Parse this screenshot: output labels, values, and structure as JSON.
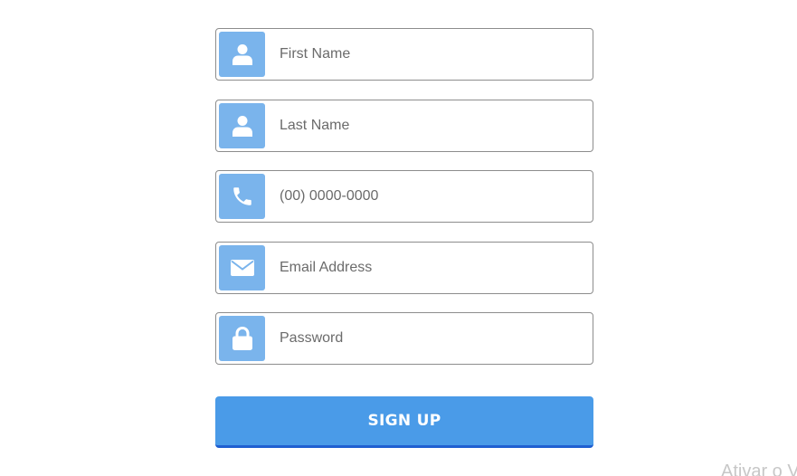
{
  "form": {
    "fields": [
      {
        "icon": "user-icon",
        "placeholder": "First Name",
        "value": ""
      },
      {
        "icon": "user-icon",
        "placeholder": "Last Name",
        "value": ""
      },
      {
        "icon": "phone-icon",
        "placeholder": "(00) 0000-0000",
        "value": ""
      },
      {
        "icon": "envelope-icon",
        "placeholder": "Email Address",
        "value": ""
      },
      {
        "icon": "lock-icon",
        "placeholder": "Password",
        "value": ""
      }
    ],
    "submit_label": "SIGN UP"
  },
  "watermark": {
    "text": "Ativar o V"
  },
  "colors": {
    "icon_bg": "#7ab4ec",
    "button_bg": "#4a9be8",
    "button_border": "#1f5fd1",
    "field_border": "#8d8d8d"
  }
}
